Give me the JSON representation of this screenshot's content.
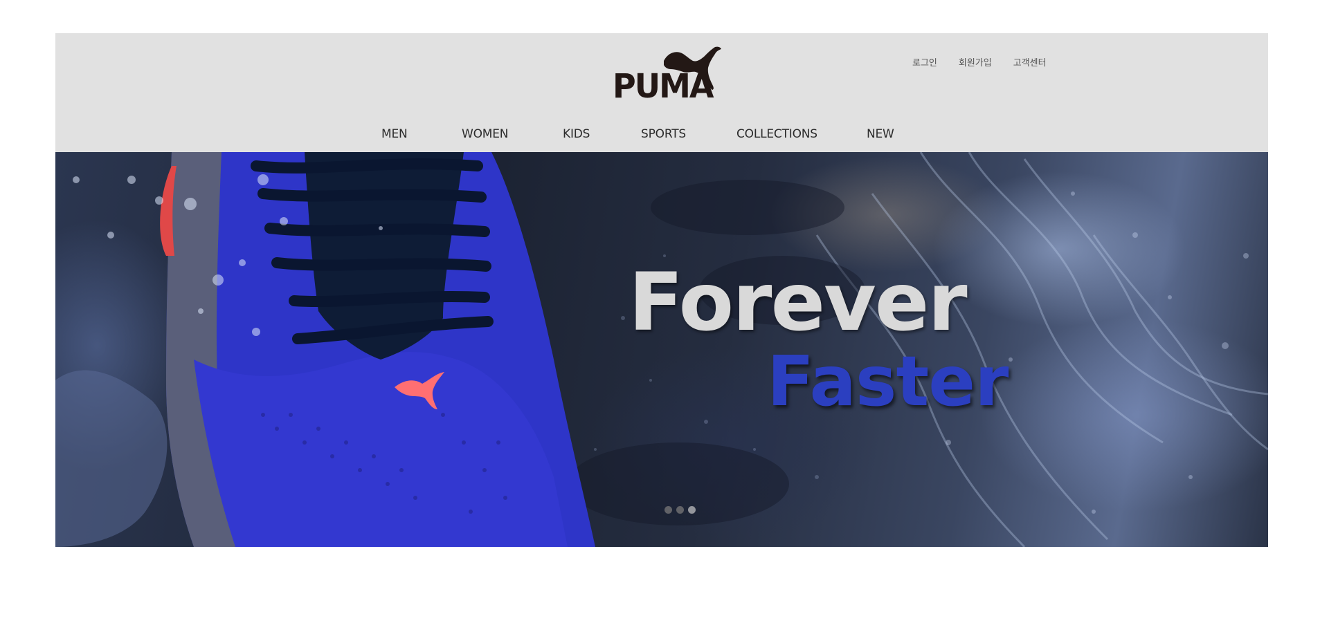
{
  "brand": {
    "logo_text": "PUMA",
    "logo_icon": "puma-cat-icon",
    "logo_color": "#231815"
  },
  "util_nav": {
    "login": "로그인",
    "signup": "회원가입",
    "support": "고객센터"
  },
  "main_nav": {
    "items": [
      {
        "label": "MEN"
      },
      {
        "label": "WOMEN"
      },
      {
        "label": "KIDS"
      },
      {
        "label": "SPORTS"
      },
      {
        "label": "COLLECTIONS"
      },
      {
        "label": "NEW"
      }
    ]
  },
  "hero": {
    "headline_1": "Forever",
    "headline_2": "Faster",
    "headline_1_color": "#d9d9d9",
    "headline_2_color": "#2b3fc0",
    "slides": {
      "count": 3,
      "active_index": 2
    }
  },
  "colors": {
    "header_bg": "#e1e1e1",
    "shoe_blue": "#3a3fd6"
  }
}
